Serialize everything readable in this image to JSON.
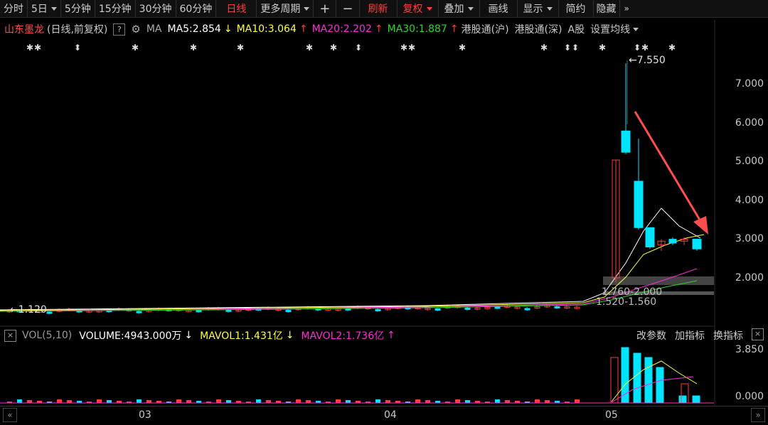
{
  "toolbar": {
    "items": [
      "分时",
      "5日",
      "5分钟",
      "15分钟",
      "30分钟",
      "60分钟",
      "日线",
      "更多周期",
      "+",
      "−",
      "刷新",
      "复权",
      "叠加",
      "画线",
      "显示",
      "简约",
      "隐藏"
    ],
    "more_arrows": "»",
    "active": "日线"
  },
  "info": {
    "stock_name": "山东墨龙",
    "mode": "(日线,前复权)",
    "help": "?",
    "ma_label": "MA",
    "ma5": "MA5:2.854",
    "ma10": "MA10:3.064",
    "ma20": "MA20:2.202",
    "ma30": "MA30:1.887",
    "hk_sh": "港股通(沪)",
    "hk_sz": "港股通(深)",
    "a_share": "A股",
    "ma_settings": "设置均线",
    "arrow_down": "↓",
    "arrow_up": "↑"
  },
  "price_axis": [
    "7.000",
    "6.000",
    "5.000",
    "4.000",
    "3.000",
    "2.000"
  ],
  "annotations": {
    "high": "7.550",
    "low": "1.120",
    "chip_upper": "1.760-2.000",
    "chip_lower": "1.520-1.560"
  },
  "volume": {
    "label": "VOL(5,10)",
    "volume": "VOLUME:4943.000万",
    "mavol1": "MAVOL1:1.431亿",
    "mavol2": "MAVOL2:1.736亿",
    "axis_top": "3.850",
    "axis_bottom": "0.000",
    "arrow_down": "↓",
    "arrow_up": "↑",
    "buttons": [
      "改参数",
      "加指标",
      "换指标"
    ],
    "close": "×"
  },
  "x_axis": [
    "03",
    "04",
    "05"
  ],
  "scroll": {
    "left": "«",
    "right": "»"
  },
  "colors": {
    "up": "#ff3b3b",
    "down": "#00e5ff",
    "ma5": "#ffffff",
    "ma10": "#ffff3b",
    "ma20": "#ff2bd6",
    "ma30": "#2bd62b"
  },
  "recent_candles": [
    {
      "open": 2.0,
      "close": 5.05,
      "high": 5.05,
      "low": 1.9,
      "dir": "up"
    },
    {
      "open": 5.8,
      "close": 5.25,
      "high": 7.55,
      "low": 5.2,
      "dir": "down"
    },
    {
      "open": 4.5,
      "close": 3.3,
      "high": 5.6,
      "low": 3.25,
      "dir": "down"
    },
    {
      "open": 3.3,
      "close": 2.8,
      "high": 3.3,
      "low": 2.75,
      "dir": "down"
    },
    {
      "open": 2.85,
      "close": 2.95,
      "high": 3.0,
      "low": 2.7,
      "dir": "up"
    },
    {
      "open": 3.0,
      "close": 2.9,
      "high": 3.05,
      "low": 2.85,
      "dir": "down"
    },
    {
      "open": 2.95,
      "close": 3.0,
      "high": 3.05,
      "low": 2.85,
      "dir": "up"
    },
    {
      "open": 3.0,
      "close": 2.75,
      "high": 3.0,
      "low": 2.7,
      "dir": "down"
    }
  ]
}
